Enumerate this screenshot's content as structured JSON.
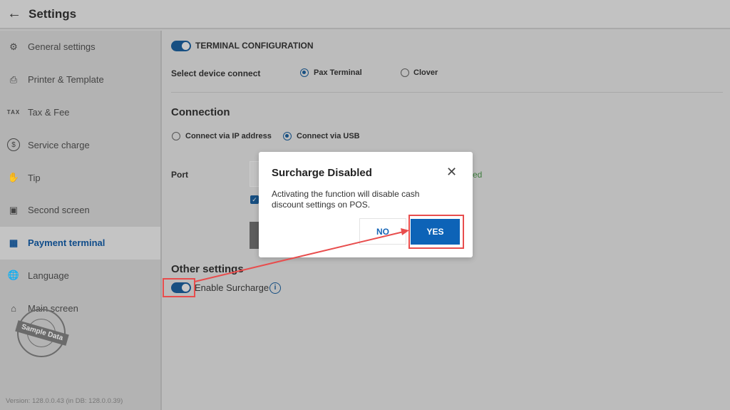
{
  "header": {
    "title": "Settings"
  },
  "sidebar": {
    "items": [
      {
        "label": "General settings",
        "icon": "gear-icon"
      },
      {
        "label": "Printer & Template",
        "icon": "printer-icon"
      },
      {
        "label": "Tax & Fee",
        "icon": "tax-icon",
        "icon_text": "TAX"
      },
      {
        "label": "Service charge",
        "icon": "dollar-icon"
      },
      {
        "label": "Tip",
        "icon": "tip-icon"
      },
      {
        "label": "Second screen",
        "icon": "screen-icon"
      },
      {
        "label": "Payment terminal",
        "icon": "terminal-icon",
        "active": true
      },
      {
        "label": "Language",
        "icon": "globe-icon"
      },
      {
        "label": "Main screen",
        "icon": "home-icon"
      }
    ],
    "stamp": "Sample Data",
    "version": "Version:  128.0.0.43 (in DB: 128.0.0.39)"
  },
  "main": {
    "terminal_config": "TERMINAL CONFIGURATION",
    "select_device_label": "Select device connect",
    "device_options": [
      "Pax Terminal",
      "Clover"
    ],
    "connection_heading": "Connection",
    "connection_options": [
      "Connect via IP address",
      "Connect via USB"
    ],
    "port_label": "Port",
    "status_fragment": "ed",
    "other_heading": "Other settings",
    "enable_surcharge": "Enable Surcharge"
  },
  "dialog": {
    "title": "Surcharge Disabled",
    "message": "Activating the function will disable cash discount settings on POS.",
    "no": "NO",
    "yes": "YES"
  },
  "colors": {
    "accent": "#0d63b7",
    "annotation": "#e84d4d"
  }
}
